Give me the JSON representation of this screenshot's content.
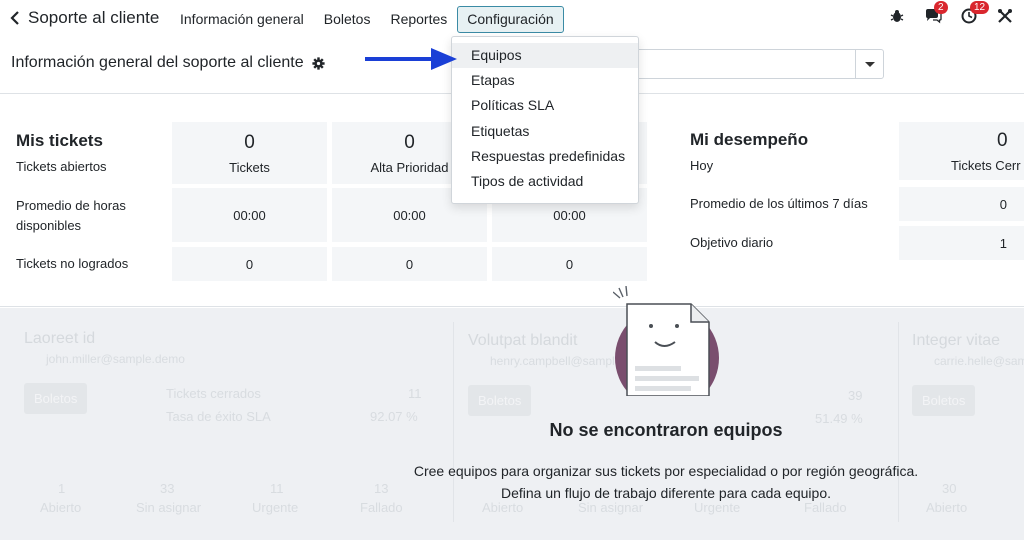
{
  "app": {
    "title": "Soporte al cliente",
    "menu": [
      "Información general",
      "Boletos",
      "Reportes",
      "Configuración"
    ],
    "systray": {
      "messages_badge": "2",
      "activity_badge": "12"
    }
  },
  "control_panel": {
    "title": "Información general del soporte al cliente"
  },
  "config_menu": {
    "items": [
      "Equipos",
      "Etapas",
      "Políticas SLA",
      "Etiquetas",
      "Respuestas predefinidas",
      "Tipos de actividad"
    ]
  },
  "my_tickets": {
    "title": "Mis tickets",
    "rows": [
      "Tickets abiertos",
      "Promedio de horas disponibles",
      "Tickets no logrados"
    ],
    "col1": {
      "open_value": "0",
      "open_label": "Tickets",
      "hours": "00:00",
      "failed": "0"
    },
    "col2": {
      "open_value": "0",
      "open_label": "Alta Prioridad",
      "hours": "00:00",
      "failed": "0"
    },
    "col3": {
      "hours": "00:00",
      "failed": "0"
    }
  },
  "performance": {
    "title": "Mi desempeño",
    "rows": [
      "Hoy",
      "Promedio de los últimos 7 días",
      "Objetivo diario"
    ],
    "col1": {
      "today_value": "0",
      "today_label": "Tickets Cerr",
      "avg": "0",
      "target": "1"
    }
  },
  "sample_teams": [
    {
      "name": "Laoreet id",
      "email": "john.miller@sample.demo",
      "button": "Boletos",
      "closed_label": "Tickets cerrados",
      "closed": "11",
      "sla_label": "Tasa de éxito SLA",
      "sla": "92.07 %",
      "stats": [
        [
          "1",
          "Abierto"
        ],
        [
          "33",
          "Sin asignar"
        ],
        [
          "11",
          "Urgente"
        ],
        [
          "13",
          "Fallado"
        ]
      ]
    },
    {
      "name": "Volutpat blandit",
      "email": "henry.campbell@sample.demo",
      "button": "Boletos",
      "closed_label": "Tickets cerrados",
      "closed": "39",
      "sla_label": "Tasa de éxito SLA",
      "sla": "51.49 %",
      "stats": [
        [
          "20",
          "Abierto"
        ],
        [
          "",
          "Sin asignar"
        ],
        [
          "",
          "Urgente"
        ],
        [
          "",
          "Fallado"
        ]
      ]
    },
    {
      "name": "Integer vitae",
      "email": "carrie.helle@sample.demo",
      "button": "Boletos",
      "stats": [
        [
          "30",
          "Abierto"
        ]
      ]
    }
  ],
  "empty_state": {
    "title": "No se encontraron equipos",
    "line1": "Cree equipos para organizar sus tickets por especialidad o por región geográfica.",
    "line2": "Defina un flujo de trabajo diferente para cada equipo."
  },
  "colors": {
    "active_menu_border": "#3b8ba5",
    "arrow": "#1a3fd6",
    "badge": "#d9272e",
    "illustration_circle": "#7a4e6e"
  },
  "icons": [
    "chevron-left-icon",
    "bug-icon",
    "chat-icon",
    "clock-icon",
    "tools-icon",
    "gear-icon",
    "caret-down-icon"
  ]
}
